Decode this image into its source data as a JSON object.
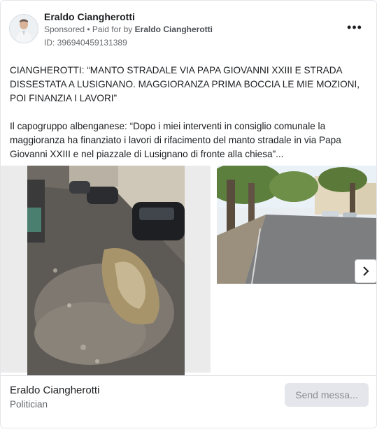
{
  "post": {
    "author": "Eraldo Ciangherotti",
    "sponsored": "Sponsored",
    "paid_prefix": "• Paid for by",
    "paid_by": "Eraldo Ciangherotti",
    "id": "ID: 396940459131389",
    "paragraph1": "CIANGHEROTTI: “MANTO STRADALE VIA PAPA GIOVANNI XXIII E STRADA DISSESTATA A LUSIGNANO. MAGGIORANZA PRIMA BOCCIA LE MIE MOZIONI, POI FINANZIA I LAVORI”",
    "paragraph2": "Il capogruppo albenganese: “Dopo i miei interventi in consiglio comunale la maggioranza ha finanziato i lavori di rifacimento del manto stradale in via Papa Giovanni XXIII e nel piazzale di Lusignano di fronte alla chiesa”..."
  },
  "footer": {
    "name": "Eraldo Ciangherotti",
    "role": "Politician",
    "send_button": "Send messa..."
  },
  "icons": {
    "more": "more-options-icon",
    "next": "chevron-right-icon",
    "avatar": "profile-avatar"
  }
}
